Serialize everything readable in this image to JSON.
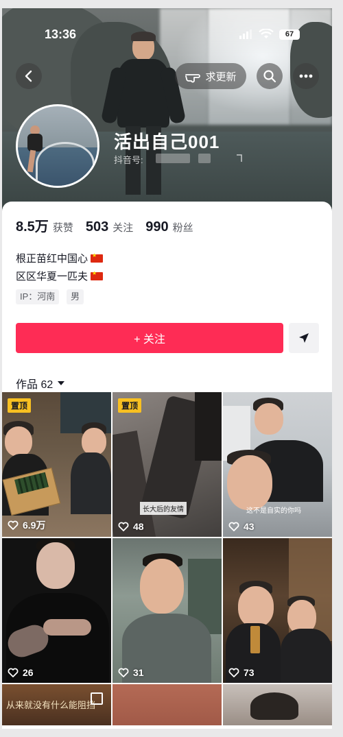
{
  "status_bar": {
    "time": "13:36",
    "battery": "67"
  },
  "header": {
    "update_button_label": "求更新"
  },
  "profile": {
    "nickname": "活出自己001",
    "id_label": "抖音号:",
    "stats": [
      {
        "value": "8.5万",
        "label": "获赞"
      },
      {
        "value": "503",
        "label": "关注"
      },
      {
        "value": "990",
        "label": "粉丝"
      }
    ],
    "bio_lines": [
      "根正苗红中国心",
      "区区华夏一匹夫"
    ],
    "tags": [
      "IP：河南",
      "男"
    ],
    "follow_label": "+ 关注",
    "works_label": "作品 62"
  },
  "videos": [
    {
      "likes": "6.9万",
      "pinned": true,
      "pin_label": "置顶"
    },
    {
      "likes": "48",
      "pinned": true,
      "pin_label": "置顶",
      "caption": "长大后的友情"
    },
    {
      "likes": "43",
      "pinned": false,
      "caption": "这不是自实的你吗"
    },
    {
      "likes": "26",
      "pinned": false
    },
    {
      "likes": "31",
      "pinned": false
    },
    {
      "likes": "73",
      "pinned": false
    },
    {
      "likes": "",
      "pinned": false,
      "caption": "从来就没有什么能阻挡"
    },
    {
      "likes": "",
      "pinned": false
    },
    {
      "likes": "",
      "pinned": false
    }
  ],
  "colors": {
    "accent": "#fe2c55",
    "pin": "#f8c021",
    "text": "#161823"
  }
}
